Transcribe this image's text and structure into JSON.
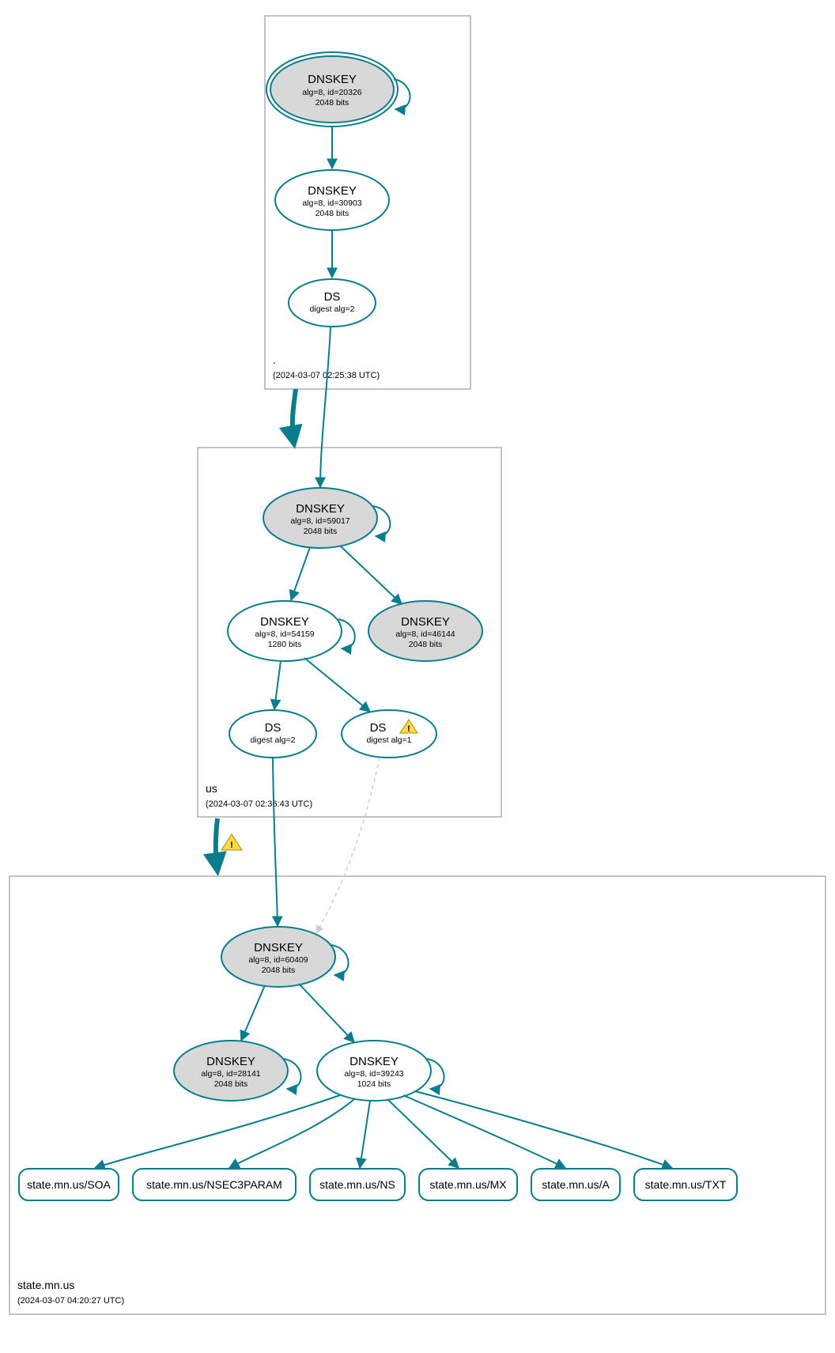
{
  "zones": {
    "root": {
      "label": ".",
      "timestamp": "(2024-03-07 02:25:38 UTC)"
    },
    "us": {
      "label": "us",
      "timestamp": "(2024-03-07 02:36:43 UTC)"
    },
    "state": {
      "label": "state.mn.us",
      "timestamp": "(2024-03-07 04:20:27 UTC)"
    }
  },
  "nodes": {
    "root_ksk": {
      "title": "DNSKEY",
      "sub1": "alg=8, id=20326",
      "sub2": "2048 bits"
    },
    "root_zsk": {
      "title": "DNSKEY",
      "sub1": "alg=8, id=30903",
      "sub2": "2048 bits"
    },
    "root_ds": {
      "title": "DS",
      "sub1": "digest alg=2"
    },
    "us_ksk": {
      "title": "DNSKEY",
      "sub1": "alg=8, id=59017",
      "sub2": "2048 bits"
    },
    "us_zsk": {
      "title": "DNSKEY",
      "sub1": "alg=8, id=54159",
      "sub2": "1280 bits"
    },
    "us_kskb": {
      "title": "DNSKEY",
      "sub1": "alg=8, id=46144",
      "sub2": "2048 bits"
    },
    "us_ds1": {
      "title": "DS",
      "sub1": "digest alg=2"
    },
    "us_ds2": {
      "title": "DS",
      "sub1": "digest alg=1"
    },
    "st_ksk": {
      "title": "DNSKEY",
      "sub1": "alg=8, id=60409",
      "sub2": "2048 bits"
    },
    "st_kskb": {
      "title": "DNSKEY",
      "sub1": "alg=8, id=28141",
      "sub2": "2048 bits"
    },
    "st_zsk": {
      "title": "DNSKEY",
      "sub1": "alg=8, id=39243",
      "sub2": "1024 bits"
    }
  },
  "rrsets": {
    "soa": "state.mn.us/SOA",
    "nsec": "state.mn.us/NSEC3PARAM",
    "ns": "state.mn.us/NS",
    "mx": "state.mn.us/MX",
    "a": "state.mn.us/A",
    "txt": "state.mn.us/TXT"
  },
  "chart_data": {
    "type": "diagram",
    "description": "DNSSEC authentication chain diagram",
    "zones": [
      {
        "name": ".",
        "timestamp": "2024-03-07 02:25:38 UTC",
        "keys": [
          {
            "type": "DNSKEY",
            "alg": 8,
            "id": 20326,
            "bits": 2048,
            "role": "KSK",
            "trust_anchor": true
          },
          {
            "type": "DNSKEY",
            "alg": 8,
            "id": 30903,
            "bits": 2048,
            "role": "ZSK"
          }
        ],
        "ds": [
          {
            "digest_alg": 2
          }
        ]
      },
      {
        "name": "us",
        "timestamp": "2024-03-07 02:36:43 UTC",
        "keys": [
          {
            "type": "DNSKEY",
            "alg": 8,
            "id": 59017,
            "bits": 2048,
            "role": "KSK"
          },
          {
            "type": "DNSKEY",
            "alg": 8,
            "id": 54159,
            "bits": 1280,
            "role": "ZSK"
          },
          {
            "type": "DNSKEY",
            "alg": 8,
            "id": 46144,
            "bits": 2048,
            "role": "standby"
          }
        ],
        "ds": [
          {
            "digest_alg": 2
          },
          {
            "digest_alg": 1,
            "warning": true
          }
        ],
        "delegation_warning": true
      },
      {
        "name": "state.mn.us",
        "timestamp": "2024-03-07 04:20:27 UTC",
        "keys": [
          {
            "type": "DNSKEY",
            "alg": 8,
            "id": 60409,
            "bits": 2048,
            "role": "KSK"
          },
          {
            "type": "DNSKEY",
            "alg": 8,
            "id": 28141,
            "bits": 2048,
            "role": "standby"
          },
          {
            "type": "DNSKEY",
            "alg": 8,
            "id": 39243,
            "bits": 1024,
            "role": "ZSK"
          }
        ],
        "rrsets": [
          "SOA",
          "NSEC3PARAM",
          "NS",
          "MX",
          "A",
          "TXT"
        ]
      }
    ]
  }
}
